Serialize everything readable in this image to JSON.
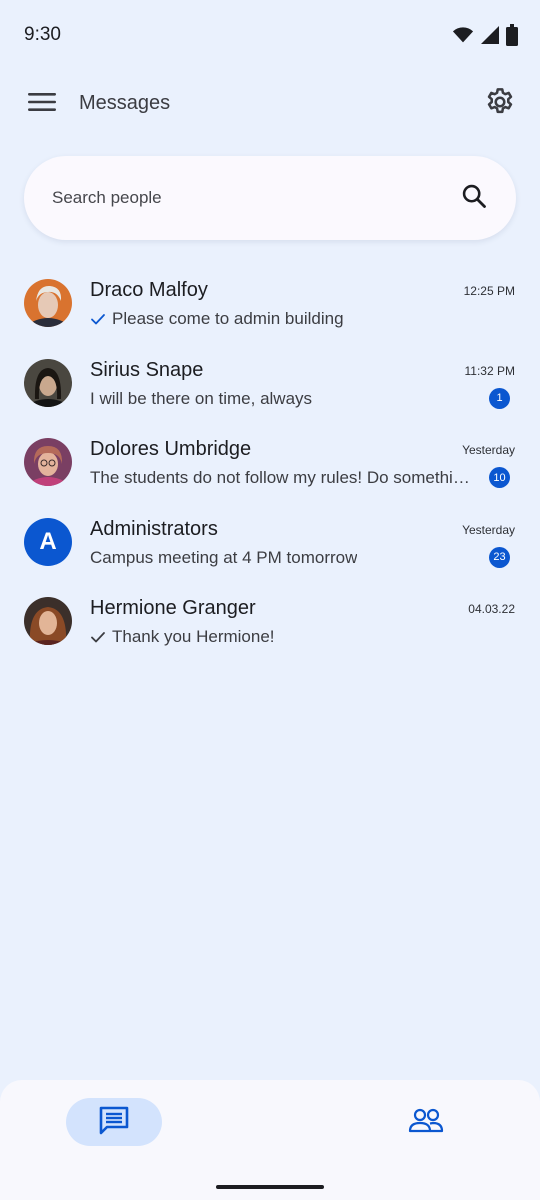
{
  "status_bar": {
    "time": "9:30",
    "icons": [
      "wifi-icon",
      "cellular-signal-icon",
      "battery-icon"
    ]
  },
  "app_bar": {
    "title": "Messages",
    "menu_icon": "hamburger-menu-icon",
    "settings_icon": "gear-icon"
  },
  "search": {
    "placeholder": "Search people",
    "value": "",
    "icon": "search-icon"
  },
  "conversations": [
    {
      "name": "Draco Malfoy",
      "time": "12:25 PM",
      "preview": "Please come to admin building",
      "sent_check": true,
      "unread": null,
      "avatar": "portrait-photo"
    },
    {
      "name": "Sirius Snape",
      "time": "11:32 PM",
      "preview": "I will be there on time, always",
      "sent_check": false,
      "unread": "1",
      "avatar": "portrait-photo"
    },
    {
      "name": "Dolores Umbridge",
      "time": "Yesterday",
      "preview": "The students do not follow my rules! Do something about it!",
      "sent_check": false,
      "unread": "10",
      "avatar": "portrait-photo"
    },
    {
      "name": "Administrators",
      "time": "Yesterday",
      "preview": "Campus meeting at 4 PM tomorrow",
      "sent_check": false,
      "unread": "23",
      "avatar_letter": "A"
    },
    {
      "name": "Hermione Granger",
      "time": "04.03.22",
      "preview": "Thank you Hermione!",
      "sent_check": true,
      "unread": null,
      "avatar": "portrait-photo"
    }
  ],
  "bottom_nav": {
    "items": [
      {
        "icon": "chat-message-icon",
        "active": true
      },
      {
        "icon": "people-group-icon",
        "active": false
      }
    ]
  },
  "colors": {
    "background": "#eaf1fd",
    "accent": "#0b57d0",
    "active_nav_pill": "#d3e3fd",
    "search_surface": "#fbf9fe"
  }
}
